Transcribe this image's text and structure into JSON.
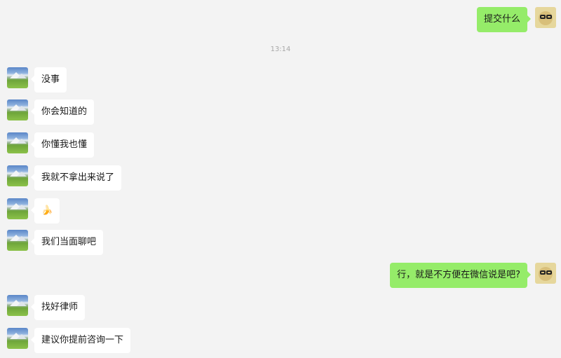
{
  "timestamp": "13:14",
  "messages": [
    {
      "side": "right",
      "text": "提交什么"
    },
    {
      "side": "left",
      "text": "没事"
    },
    {
      "side": "left",
      "text": "你会知道的"
    },
    {
      "side": "left",
      "text": "你懂我也懂"
    },
    {
      "side": "left",
      "text": "我就不拿出来说了"
    },
    {
      "side": "left",
      "text": "🍌"
    },
    {
      "side": "left",
      "text": "我们当面聊吧"
    },
    {
      "side": "right",
      "text": "行，就是不方便在微信说是吧?"
    },
    {
      "side": "left",
      "text": "找好律师"
    },
    {
      "side": "left",
      "text": "建议你提前咨询一下"
    }
  ],
  "colors": {
    "background": "#f3f3f3",
    "self_bubble": "#95ec69",
    "other_bubble": "#ffffff",
    "timestamp_text": "#a8a8a8"
  }
}
